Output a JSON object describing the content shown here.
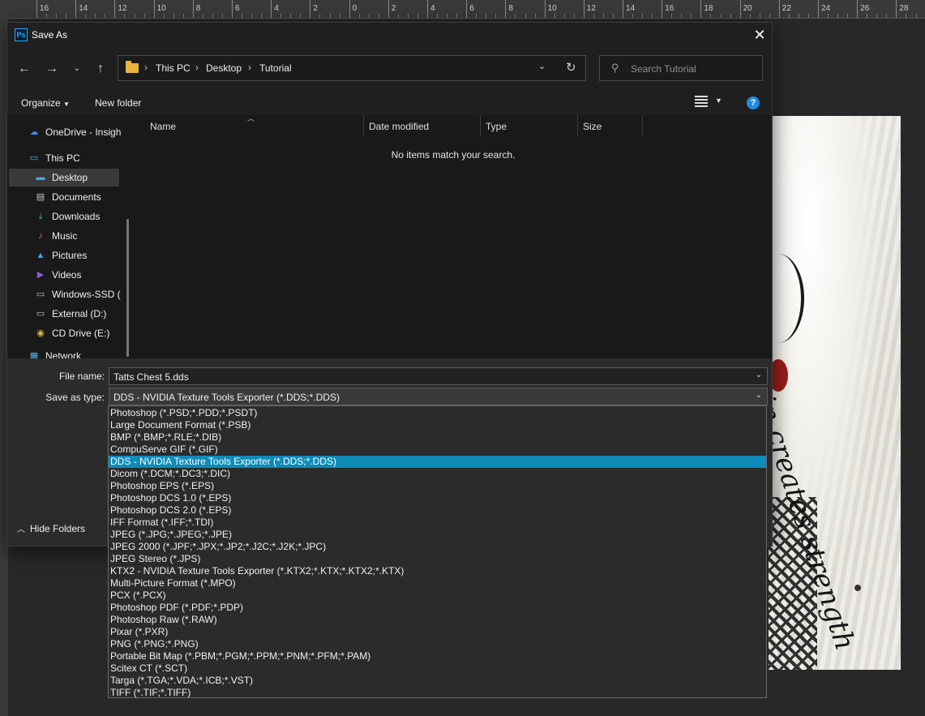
{
  "ruler_labels": [
    "16",
    "14",
    "12",
    "10",
    "8",
    "6",
    "4",
    "2",
    "0",
    "2",
    "4",
    "6",
    "8",
    "10",
    "12",
    "14",
    "16",
    "18",
    "20",
    "22",
    "24",
    "26",
    "28"
  ],
  "canvas": {
    "script_text": "Pain creates strength"
  },
  "dialog": {
    "title": "Save As",
    "app_icon_text": "Ps",
    "breadcrumbs": [
      "This PC",
      "Desktop",
      "Tutorial"
    ],
    "search_placeholder": "Search Tutorial",
    "organize_label": "Organize",
    "new_folder_label": "New folder",
    "nav_items": [
      {
        "label": "OneDrive - Insigh",
        "icon": "cloud-icon"
      },
      {
        "label": "This PC",
        "icon": "computer-icon"
      },
      {
        "label": "Desktop",
        "icon": "desktop-icon",
        "selected": true
      },
      {
        "label": "Documents",
        "icon": "documents-icon"
      },
      {
        "label": "Downloads",
        "icon": "download-icon"
      },
      {
        "label": "Music",
        "icon": "music-icon"
      },
      {
        "label": "Pictures",
        "icon": "pictures-icon"
      },
      {
        "label": "Videos",
        "icon": "videos-icon"
      },
      {
        "label": "Windows-SSD (",
        "icon": "drive-icon"
      },
      {
        "label": "External (D:)",
        "icon": "drive-icon"
      },
      {
        "label": "CD Drive (E:)",
        "icon": "cd-icon"
      },
      {
        "label": "Network",
        "icon": "network-icon"
      }
    ],
    "columns": [
      "Name",
      "Date modified",
      "Type",
      "Size"
    ],
    "empty_message": "No items match your search.",
    "file_name_label": "File name:",
    "file_name_value": "Tatts Chest 5.dds",
    "save_type_label": "Save as type:",
    "save_type_value": "DDS - NVIDIA Texture Tools Exporter (*.DDS;*.DDS)",
    "hide_folders_label": "Hide Folders",
    "save_type_options": [
      "Photoshop (*.PSD;*.PDD;*.PSDT)",
      "Large Document Format (*.PSB)",
      "BMP (*.BMP;*.RLE;*.DIB)",
      "CompuServe GIF (*.GIF)",
      "DDS - NVIDIA Texture Tools Exporter (*.DDS;*.DDS)",
      "Dicom (*.DCM;*.DC3;*.DIC)",
      "Photoshop EPS (*.EPS)",
      "Photoshop DCS 1.0 (*.EPS)",
      "Photoshop DCS 2.0 (*.EPS)",
      "IFF Format (*.IFF;*.TDI)",
      "JPEG (*.JPG;*.JPEG;*.JPE)",
      "JPEG 2000 (*.JPF;*.JPX;*.JP2;*.J2C;*.J2K;*.JPC)",
      "JPEG Stereo (*.JPS)",
      "KTX2 - NVIDIA Texture Tools Exporter (*.KTX2;*.KTX;*.KTX2;*.KTX)",
      "Multi-Picture Format (*.MPO)",
      "PCX (*.PCX)",
      "Photoshop PDF (*.PDF;*.PDP)",
      "Photoshop Raw (*.RAW)",
      "Pixar (*.PXR)",
      "PNG (*.PNG;*.PNG)",
      "Portable Bit Map (*.PBM;*.PGM;*.PPM;*.PNM;*.PFM;*.PAM)",
      "Scitex CT (*.SCT)",
      "Targa (*.TGA;*.VDA;*.ICB;*.VST)",
      "TIFF (*.TIF;*.TIFF)"
    ],
    "selected_option_index": 4
  },
  "colors": {
    "selection": "#0e8bb8",
    "folder": "#e8b43c",
    "help": "#1f8be0"
  }
}
